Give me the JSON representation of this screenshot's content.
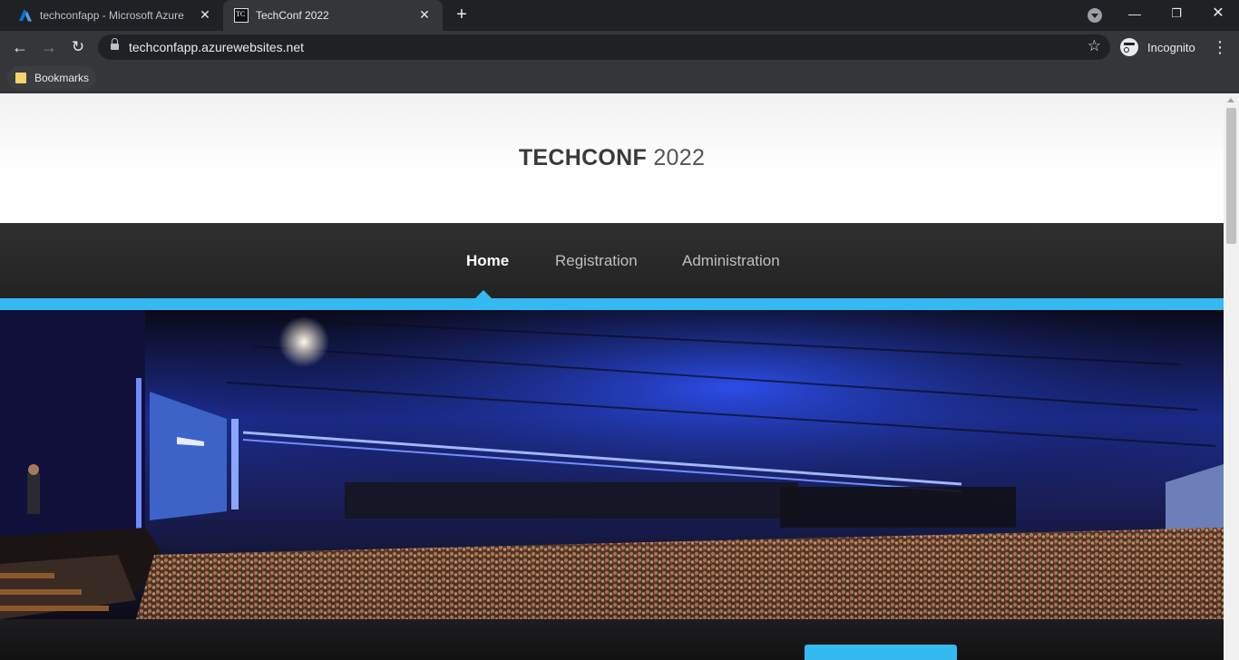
{
  "browser": {
    "tabs": [
      {
        "title": "techconfapp - Microsoft Azure",
        "icon": "azure-icon",
        "active": false
      },
      {
        "title": "TechConf 2022",
        "icon": "tc-favicon",
        "favicon_text": "TC",
        "active": true
      }
    ],
    "new_tab_icon": "plus-icon",
    "url": "techconfapp.azurewebsites.net",
    "profile_label": "Incognito",
    "bookmark_label": "Bookmarks"
  },
  "site": {
    "brand_bold": "TECHCONF",
    "brand_year": "2022",
    "nav": [
      {
        "label": "Home",
        "active": true
      },
      {
        "label": "Registration",
        "active": false
      },
      {
        "label": "Administration",
        "active": false
      }
    ],
    "hero_image": "conference-auditorium-photo"
  },
  "colors": {
    "accent": "#35b9f1",
    "nav_bg": "#2b2b2b",
    "chrome_bg": "#202124"
  }
}
